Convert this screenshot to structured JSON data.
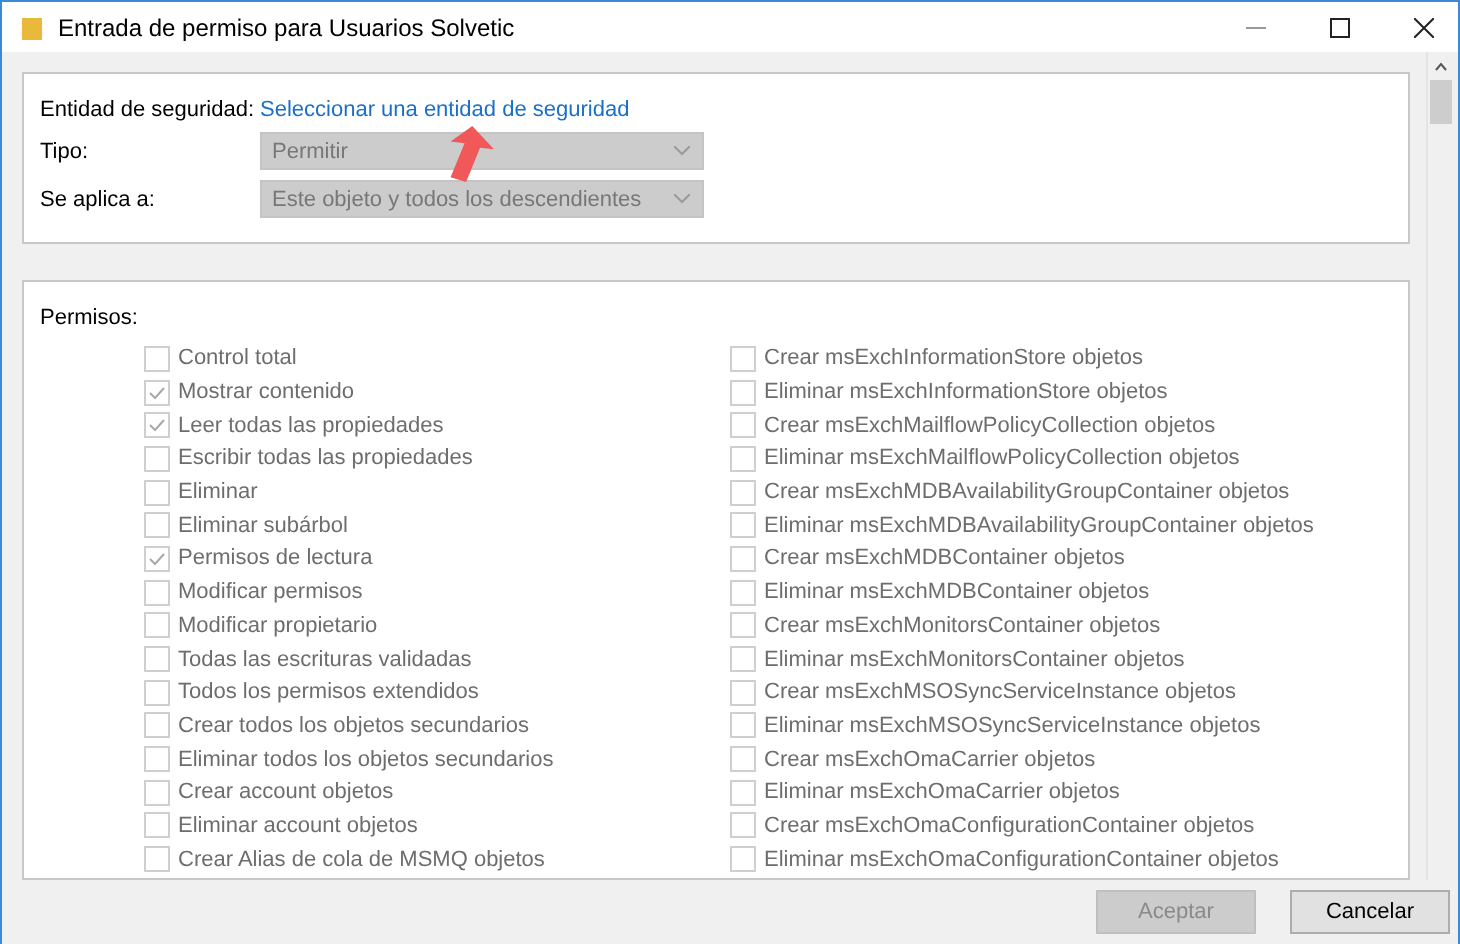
{
  "window": {
    "title": "Entrada de permiso para Usuarios Solvetic"
  },
  "principal": {
    "label": "Entidad de seguridad:",
    "link": "Seleccionar una entidad de seguridad"
  },
  "fields": [
    {
      "label": "Tipo:",
      "value": "Permitir",
      "disabled": true
    },
    {
      "label": "Se aplica a:",
      "value": "Este objeto y todos los descendientes",
      "disabled": true
    }
  ],
  "permissions": {
    "label": "Permisos:",
    "columns": [
      [
        {
          "label": "Control total",
          "checked": false,
          "disabled": true
        },
        {
          "label": "Mostrar contenido",
          "checked": true,
          "disabled": true
        },
        {
          "label": "Leer todas las propiedades",
          "checked": true,
          "disabled": true
        },
        {
          "label": "Escribir todas las propiedades",
          "checked": false,
          "disabled": true
        },
        {
          "label": "Eliminar",
          "checked": false,
          "disabled": true
        },
        {
          "label": "Eliminar subárbol",
          "checked": false,
          "disabled": true
        },
        {
          "label": "Permisos de lectura",
          "checked": true,
          "disabled": true
        },
        {
          "label": "Modificar permisos",
          "checked": false,
          "disabled": true
        },
        {
          "label": "Modificar propietario",
          "checked": false,
          "disabled": true
        },
        {
          "label": "Todas las escrituras validadas",
          "checked": false,
          "disabled": true
        },
        {
          "label": "Todos los permisos extendidos",
          "checked": false,
          "disabled": true
        },
        {
          "label": "Crear todos los objetos secundarios",
          "checked": false,
          "disabled": true
        },
        {
          "label": "Eliminar todos los objetos secundarios",
          "checked": false,
          "disabled": true
        },
        {
          "label": "Crear account objetos",
          "checked": false,
          "disabled": true
        },
        {
          "label": "Eliminar account objetos",
          "checked": false,
          "disabled": true
        },
        {
          "label": "Crear Alias de cola de MSMQ objetos",
          "checked": false,
          "disabled": true
        }
      ],
      [
        {
          "label": "Crear msExchInformationStore objetos",
          "checked": false,
          "disabled": true
        },
        {
          "label": "Eliminar msExchInformationStore objetos",
          "checked": false,
          "disabled": true
        },
        {
          "label": "Crear msExchMailflowPolicyCollection objetos",
          "checked": false,
          "disabled": true
        },
        {
          "label": "Eliminar msExchMailflowPolicyCollection objetos",
          "checked": false,
          "disabled": true
        },
        {
          "label": "Crear msExchMDBAvailabilityGroupContainer objetos",
          "checked": false,
          "disabled": true
        },
        {
          "label": "Eliminar msExchMDBAvailabilityGroupContainer objetos",
          "checked": false,
          "disabled": true
        },
        {
          "label": "Crear msExchMDBContainer objetos",
          "checked": false,
          "disabled": true
        },
        {
          "label": "Eliminar msExchMDBContainer objetos",
          "checked": false,
          "disabled": true
        },
        {
          "label": "Crear msExchMonitorsContainer objetos",
          "checked": false,
          "disabled": true
        },
        {
          "label": "Eliminar msExchMonitorsContainer objetos",
          "checked": false,
          "disabled": true
        },
        {
          "label": "Crear msExchMSOSyncServiceInstance objetos",
          "checked": false,
          "disabled": true
        },
        {
          "label": "Eliminar msExchMSOSyncServiceInstance objetos",
          "checked": false,
          "disabled": true
        },
        {
          "label": "Crear msExchOmaCarrier objetos",
          "checked": false,
          "disabled": true
        },
        {
          "label": "Eliminar msExchOmaCarrier objetos",
          "checked": false,
          "disabled": true
        },
        {
          "label": "Crear msExchOmaConfigurationContainer objetos",
          "checked": false,
          "disabled": true
        },
        {
          "label": "Eliminar msExchOmaConfigurationContainer objetos",
          "checked": false,
          "disabled": true
        }
      ]
    ]
  },
  "buttons": [
    {
      "label": "Aceptar",
      "disabled": true
    },
    {
      "label": "Cancelar",
      "disabled": false
    }
  ]
}
